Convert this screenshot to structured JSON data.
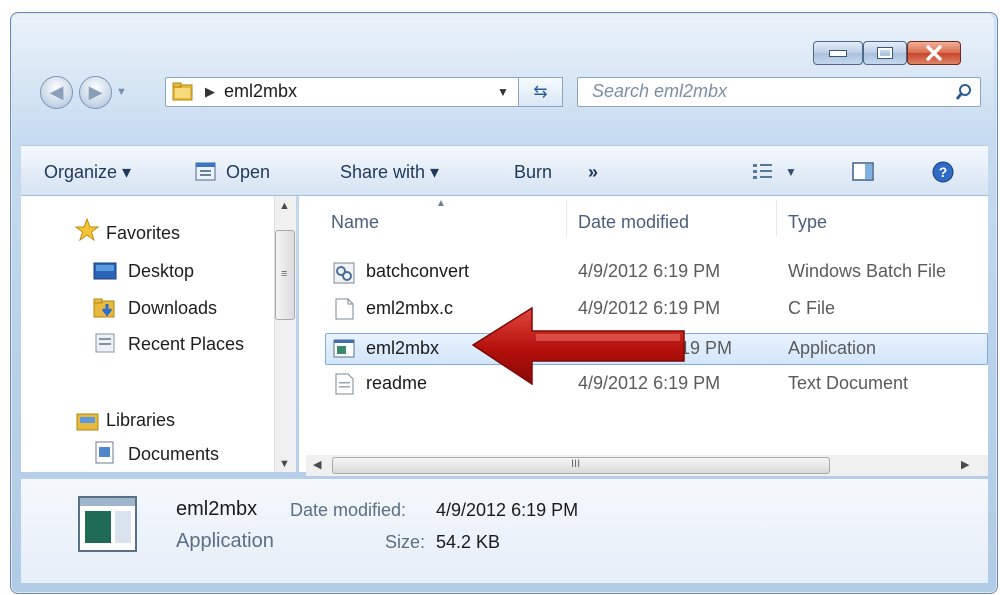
{
  "address": {
    "path_segment": "eml2mbx"
  },
  "search": {
    "placeholder": "Search eml2mbx"
  },
  "commands": {
    "organize": "Organize ▾",
    "open": "Open",
    "share_with": "Share with ▾",
    "burn": "Burn",
    "more": "»"
  },
  "nav": {
    "favorites": "Favorites",
    "desktop": "Desktop",
    "downloads": "Downloads",
    "recent_places": "Recent Places",
    "libraries": "Libraries",
    "documents": "Documents"
  },
  "columns": {
    "name": "Name",
    "date_modified": "Date modified",
    "type": "Type"
  },
  "files": [
    {
      "name": "batchconvert",
      "date": "4/9/2012 6:19 PM",
      "type": "Windows Batch File"
    },
    {
      "name": "eml2mbx.c",
      "date": "4/9/2012 6:19 PM",
      "type": "C File"
    },
    {
      "name": "eml2mbx",
      "date": "19 PM",
      "type": "Application"
    },
    {
      "name": "readme",
      "date": "4/9/2012 6:19 PM",
      "type": "Text Document"
    }
  ],
  "details": {
    "name": "eml2mbx",
    "kind": "Application",
    "date_label": "Date modified:",
    "date_value": "4/9/2012 6:19 PM",
    "size_label": "Size:",
    "size_value": "54.2 KB"
  },
  "scrollbar": {
    "grip": "III"
  },
  "colors": {
    "selection": "#d3e6fb",
    "arrow": "#c0150c",
    "close_button": "#c7442a"
  }
}
